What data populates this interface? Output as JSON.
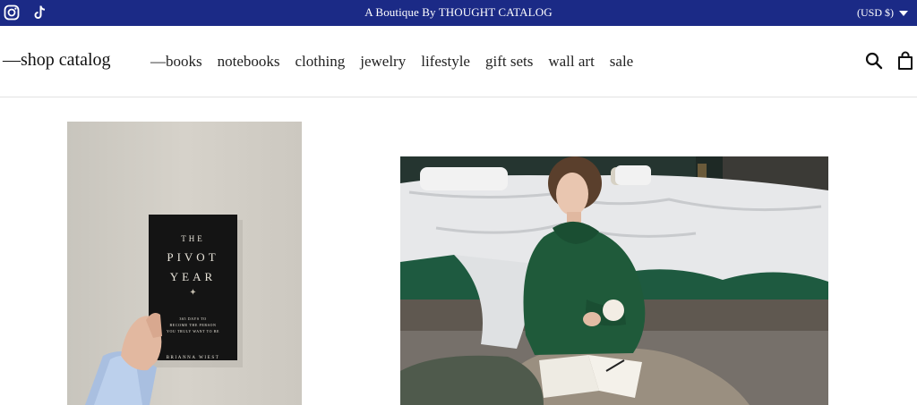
{
  "announcement_bar": {
    "text": "A Boutique By THOUGHT CATALOG",
    "currency_label": "(USD $)",
    "social_icons": [
      "instagram-icon",
      "tiktok-icon"
    ],
    "background_color": "#1b2a86"
  },
  "header": {
    "logo_text": "—shop catalog",
    "nav": [
      {
        "label": "—books"
      },
      {
        "label": "notebooks"
      },
      {
        "label": "clothing"
      },
      {
        "label": "jewelry"
      },
      {
        "label": "lifestyle"
      },
      {
        "label": "gift sets"
      },
      {
        "label": "wall art"
      },
      {
        "label": "sale"
      }
    ],
    "icons": [
      "search-icon",
      "cart-icon"
    ]
  },
  "hero": {
    "book_cover": {
      "title_line1": "THE",
      "title_line2": "PIVOT",
      "title_line3": "YEAR",
      "subtitle_lines": [
        "365 DAYS TO",
        "BECOME THE PERSON",
        "YOU TRULY WANT TO BE"
      ],
      "author": "BRIANNA WIEST"
    }
  }
}
